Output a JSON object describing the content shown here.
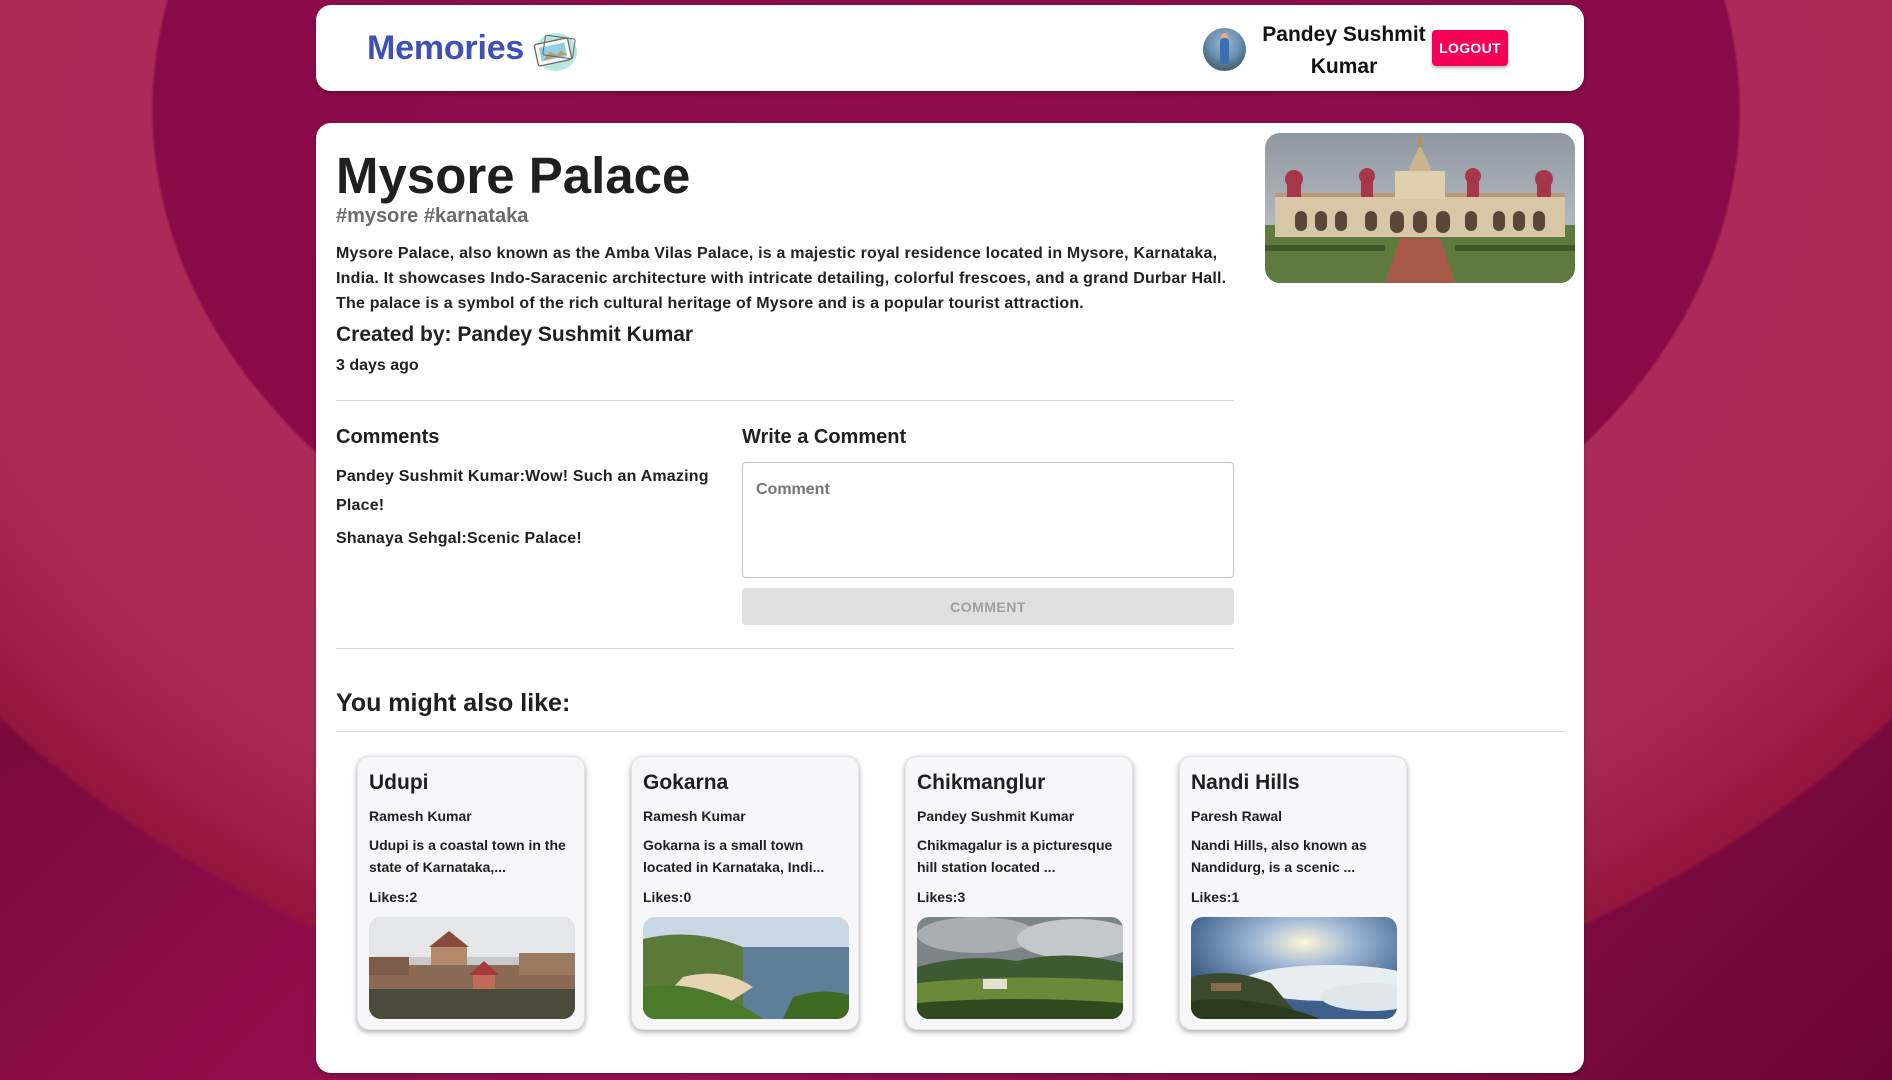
{
  "header": {
    "brand": "Memories",
    "user_name": "Pandey Sushmit Kumar",
    "logout_label": "LOGOUT"
  },
  "post": {
    "title": "Mysore Palace",
    "tags": "#mysore #karnataka",
    "message": "Mysore Palace, also known as the Amba Vilas Palace, is a majestic royal residence located in Mysore, Karnataka, India. It showcases Indo-Saracenic architecture with intricate detailing, colorful frescoes, and a grand Durbar Hall. The palace is a symbol of the rich cultural heritage of Mysore and is a popular tourist attraction.",
    "created_by": "Created by: Pandey Sushmit Kumar",
    "time_ago": "3 days ago"
  },
  "comments": {
    "heading": "Comments",
    "items": [
      "Pandey Sushmit Kumar:Wow! Such an Amazing Place!",
      "Shanaya Sehgal:Scenic Palace!"
    ]
  },
  "write_comment": {
    "heading": "Write a Comment",
    "placeholder": "Comment",
    "button_label": "COMMENT"
  },
  "recommended": {
    "heading": "You might also like:",
    "cards": [
      {
        "title": "Udupi",
        "author": "Ramesh Kumar",
        "message": "Udupi is a coastal town in the state of Karnataka,...",
        "likes": "Likes:2"
      },
      {
        "title": "Gokarna",
        "author": "Ramesh Kumar",
        "message": "Gokarna is a small town located in Karnataka, Indi...",
        "likes": "Likes:0"
      },
      {
        "title": "Chikmanglur",
        "author": "Pandey Sushmit Kumar",
        "message": "Chikmagalur is a picturesque hill station located ...",
        "likes": "Likes:3"
      },
      {
        "title": "Nandi Hills",
        "author": "Paresh Rawal",
        "message": "Nandi Hills, also known as Nandidurg, is a scenic ...",
        "likes": "Likes:1"
      }
    ]
  },
  "colors": {
    "brand": "#3f51b5",
    "logout": "#f50057",
    "background": "#8e0c4c"
  }
}
